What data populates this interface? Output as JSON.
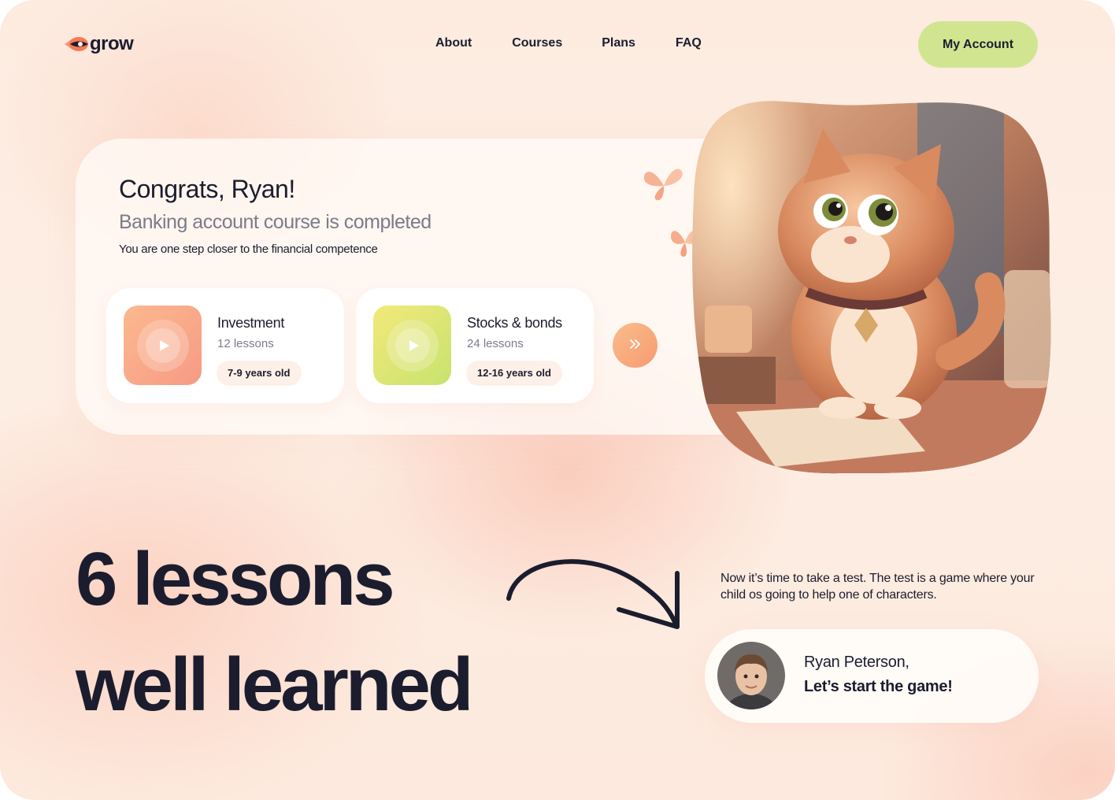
{
  "brand": {
    "name": "grow",
    "logo_icon": "rocket-fish-icon"
  },
  "nav": {
    "items": [
      {
        "label": "About"
      },
      {
        "label": "Courses"
      },
      {
        "label": "Plans"
      },
      {
        "label": "FAQ"
      }
    ],
    "account_label": "My Account"
  },
  "hero": {
    "greeting": "Congrats, Ryan!",
    "completed": "Banking account course is completed",
    "tagline": "You are one step closer to the financial competence"
  },
  "courses": [
    {
      "title": "Investment",
      "lessons": "12 lessons",
      "age": "7-9 years old",
      "icon": "play-icon"
    },
    {
      "title": "Stocks & bonds",
      "lessons": "24 lessons",
      "age": "12-16 years old",
      "icon": "play-icon"
    }
  ],
  "next_icon": "double-chevron-right-icon",
  "headline": {
    "line1": "6 lessons",
    "line2": "well learned"
  },
  "test_prompt": "Now it’s time to take a test. The test is a game where your child os going to help one of characters.",
  "game": {
    "player": "Ryan Peterson,",
    "cta": "Let’s start the game!"
  },
  "colors": {
    "text": "#1b1d2e",
    "muted": "#7b7c8a",
    "accent_green": "#d1e591",
    "accent_orange": "#f69a72"
  }
}
